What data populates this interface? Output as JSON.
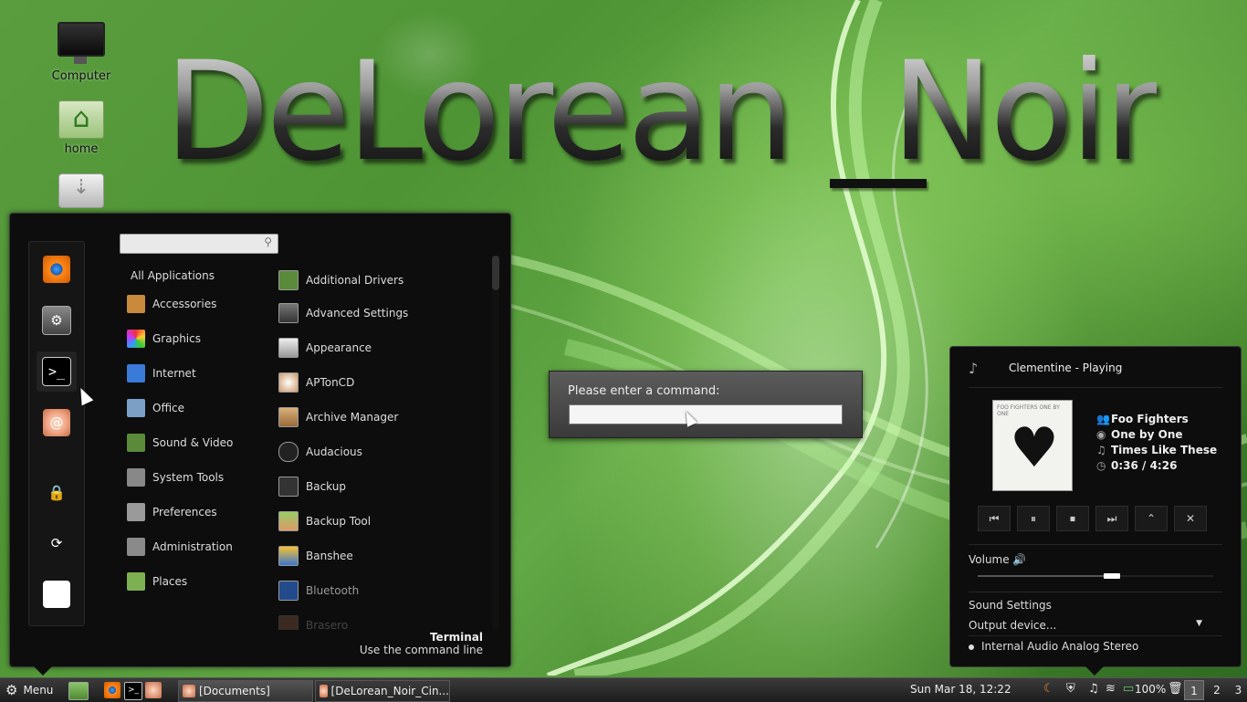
{
  "wallpaper": {
    "title_main": "DeLorean",
    "title_second": "Noir"
  },
  "desktop_icons": [
    {
      "label": "Computer",
      "icon": "monitor-icon"
    },
    {
      "label": "home",
      "icon": "home-folder-icon"
    },
    {
      "label": "",
      "icon": "usb-drive-icon"
    }
  ],
  "menu": {
    "favorites": [
      {
        "name": "eye-app-icon"
      },
      {
        "name": "settings-app-icon"
      },
      {
        "name": "terminal-icon"
      },
      {
        "name": "debian-swirl-icon"
      }
    ],
    "session": [
      {
        "name": "lock-icon",
        "glyph": "🔒"
      },
      {
        "name": "logout-icon",
        "glyph": "⟳"
      },
      {
        "name": "power-icon",
        "glyph": "⏻"
      }
    ],
    "search": {
      "placeholder": "",
      "value": ""
    },
    "categories": [
      {
        "label": "All Applications"
      },
      {
        "label": "Accessories",
        "color": "#c98a3c"
      },
      {
        "label": "Graphics",
        "color": "#e05a6a"
      },
      {
        "label": "Internet",
        "color": "#3a7ad8"
      },
      {
        "label": "Office",
        "color": "#7aa0c8"
      },
      {
        "label": "Sound & Video",
        "color": "#5a8a3a"
      },
      {
        "label": "System Tools",
        "color": "#888888"
      },
      {
        "label": "Preferences",
        "color": "#9a9a9a"
      },
      {
        "label": "Administration",
        "color": "#8a8a8a"
      },
      {
        "label": "Places",
        "color": "#7db050"
      }
    ],
    "apps": [
      {
        "label": "Additional Drivers"
      },
      {
        "label": "Advanced Settings"
      },
      {
        "label": "Appearance"
      },
      {
        "label": "APTonCD"
      },
      {
        "label": "Archive Manager"
      },
      {
        "label": "Audacious"
      },
      {
        "label": "Backup"
      },
      {
        "label": "Backup Tool"
      },
      {
        "label": "Banshee"
      },
      {
        "label": "Bluetooth"
      },
      {
        "label": "Brasero"
      }
    ],
    "footer": {
      "title": "Terminal",
      "description": "Use the command line"
    }
  },
  "run_dialog": {
    "prompt": "Please enter a command:",
    "value": ""
  },
  "sound": {
    "player_title": "Clementine - Playing",
    "album_art_text": "FOO FIGHTERS   ONE BY ONE",
    "track": {
      "artist": "Foo Fighters",
      "album": "One by One",
      "title": "Times Like These",
      "time": "0:36 / 4:26"
    },
    "controls": [
      {
        "name": "previous-button",
        "glyph": "⏮"
      },
      {
        "name": "pause-button",
        "glyph": "⏸"
      },
      {
        "name": "stop-button",
        "glyph": "⏹"
      },
      {
        "name": "next-button",
        "glyph": "⏭"
      },
      {
        "name": "eject-button",
        "glyph": "⌃"
      },
      {
        "name": "close-player-button",
        "glyph": "✕"
      }
    ],
    "volume_label": "Volume",
    "volume_level": 0.57,
    "sound_settings": "Sound Settings",
    "output_device": "Output device...",
    "output_option": "Internal Audio Analog Stereo"
  },
  "taskbar": {
    "menu_label": "Menu",
    "windows": [
      {
        "label": "[Documents]",
        "active": true
      },
      {
        "label": "[DeLorean_Noir_Cin...",
        "active": false
      }
    ],
    "clock": "Sun Mar 18, 12:22",
    "battery": "100%",
    "workspaces": [
      "1",
      "2",
      "3"
    ]
  }
}
